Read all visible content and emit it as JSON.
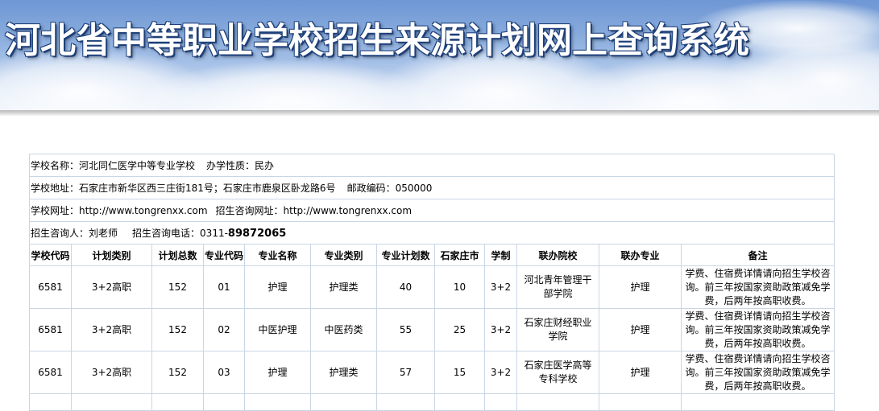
{
  "banner": {
    "title": "河北省中等职业学校招生来源计划网上查询系统"
  },
  "school": {
    "name_label": "学校名称：",
    "name": "河北同仁医学中等专业学校",
    "nature_label": "办学性质：",
    "nature": "民办",
    "address_label": "学校地址：",
    "address": "石家庄市新华区西三庄街181号；石家庄市鹿泉区卧龙路6号",
    "postcode_label": "邮政编码：",
    "postcode": "050000",
    "website_label": "学校网址：",
    "website": "http://www.tongrenxx.com",
    "enroll_site_label": "招生咨询网址：",
    "enroll_site": "http://www.tongrenxx.com",
    "contact_label": "招生咨询人：",
    "contact": "刘老师",
    "phone_label": "招生咨询电话：",
    "phone_prefix": "0311-",
    "phone_number": "89872065"
  },
  "table": {
    "headers": [
      "学校代码",
      "计划类别",
      "计划总数",
      "专业代码",
      "专业名称",
      "专业类别",
      "专业计划数",
      "石家庄市",
      "学制",
      "联办院校",
      "联办专业",
      "备注"
    ],
    "rows": [
      [
        "6581",
        "3+2高职",
        "152",
        "01",
        "护理",
        "护理类",
        "40",
        "10",
        "3+2",
        "河北青年管理干部学院",
        "护理",
        "学费、住宿费详情请向招生学校咨询。前三年按国家资助政策减免学费，后两年按高职收费。"
      ],
      [
        "6581",
        "3+2高职",
        "152",
        "02",
        "中医护理",
        "中医药类",
        "55",
        "25",
        "3+2",
        "石家庄财经职业学院",
        "护理",
        "学费、住宿费详情请向招生学校咨询。前三年按国家资助政策减免学费，后两年按高职收费。"
      ],
      [
        "6581",
        "3+2高职",
        "152",
        "03",
        "护理",
        "护理类",
        "57",
        "15",
        "3+2",
        "石家庄医学高等专科学校",
        "护理",
        "学费、住宿费详情请向招生学校咨询。前三年按国家资助政策减免学费，后两年按高职收费。"
      ]
    ]
  }
}
